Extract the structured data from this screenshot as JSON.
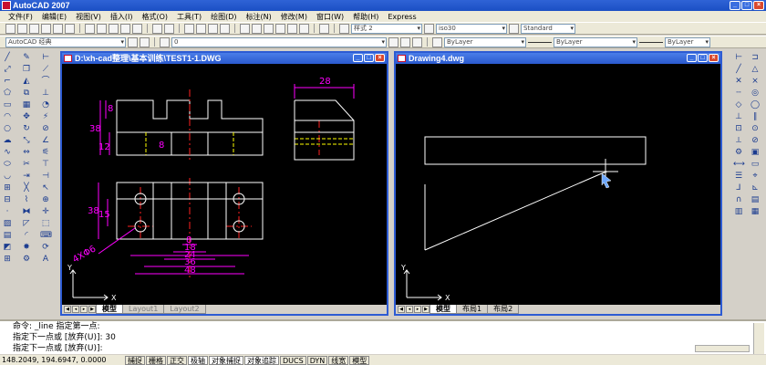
{
  "app": {
    "title": "AutoCAD 2007"
  },
  "menu": [
    "文件(F)",
    "编辑(E)",
    "视图(V)",
    "插入(I)",
    "格式(O)",
    "工具(T)",
    "绘图(D)",
    "标注(N)",
    "修改(M)",
    "窗口(W)",
    "帮助(H)",
    "Express"
  ],
  "toolbar": {
    "text_style": "样式 2",
    "dim_style": "iso30",
    "table_style": "Standard",
    "workspace": "AutoCAD 经典",
    "layer_value": "0",
    "color": "ByLayer",
    "linetype": "ByLayer",
    "lineweight": "ByLayer"
  },
  "windows": {
    "left": {
      "title": "D:\\xh-cad整理\\基本训练\\TEST1-1.DWG",
      "tabs": [
        "模型",
        "Layout1",
        "Layout2"
      ],
      "dims": [
        "28",
        "8",
        "38",
        "12",
        "8",
        "38",
        "15",
        "4XΦ6",
        "8",
        "18",
        "24",
        "36",
        "48"
      ]
    },
    "right": {
      "title": "Drawing4.dwg",
      "tabs": [
        "模型",
        "布局1",
        "布局2"
      ]
    },
    "axis": {
      "y": "Y",
      "x": "X"
    }
  },
  "command": {
    "lines": [
      "命令:  _line  指定第一点:",
      "指定下一点或 [放弃(U)]: 30",
      "指定下一点或 [放弃(U)]:"
    ]
  },
  "status": {
    "coords": "148.2049, 194.6947, 0.0000",
    "buttons": [
      "捕捉",
      "栅格",
      "正交",
      "极轴",
      "对象捕捉",
      "对象追踪",
      "DUCS",
      "DYN",
      "线宽",
      "模型"
    ]
  },
  "colors": {
    "magenta": "#ff00ff",
    "white": "#ffffff",
    "red": "#ff2020",
    "yellow": "#ffff00",
    "title_blue": "#2d5bd3"
  }
}
